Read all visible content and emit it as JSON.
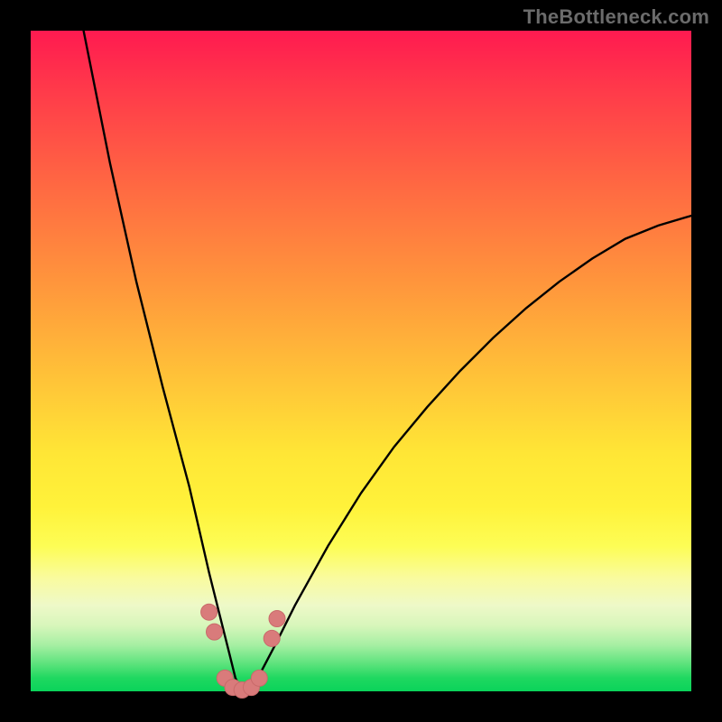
{
  "watermark": "TheBottleneck.com",
  "colors": {
    "frame": "#000000",
    "curve": "#000000",
    "marker_fill": "#d97b7b",
    "marker_stroke": "#c96a6a"
  },
  "chart_data": {
    "type": "line",
    "title": "",
    "xlabel": "",
    "ylabel": "",
    "xlim": [
      0,
      100
    ],
    "ylim": [
      0,
      100
    ],
    "grid": false,
    "series": [
      {
        "name": "bottleneck-curve",
        "description": "V-shaped bottleneck curve. y is the mismatch / bottleneck level; minimum near x≈32 where y≈0 (green band). Left arm rises steeply to ~100 at x≈8; right arm rises more gently to ~72 at x=100.",
        "x": [
          8,
          12,
          16,
          20,
          24,
          27,
          28.5,
          30,
          31,
          32,
          33,
          34,
          35,
          37,
          40,
          45,
          50,
          55,
          60,
          65,
          70,
          75,
          80,
          85,
          90,
          95,
          100
        ],
        "values": [
          100,
          80,
          62,
          46,
          31,
          18,
          12,
          6,
          2,
          0,
          0.5,
          1.6,
          3.2,
          7,
          13,
          22,
          30,
          37,
          43,
          48.5,
          53.5,
          58,
          62,
          65.5,
          68.5,
          70.5,
          72
        ]
      }
    ],
    "markers": {
      "name": "highlight-band",
      "description": "Salmon markers near the valley (inside yellow/green band).",
      "points": [
        {
          "x": 27.0,
          "y": 12.0
        },
        {
          "x": 27.8,
          "y": 9.0
        },
        {
          "x": 29.4,
          "y": 2.0
        },
        {
          "x": 30.6,
          "y": 0.6
        },
        {
          "x": 32.0,
          "y": 0.2
        },
        {
          "x": 33.4,
          "y": 0.6
        },
        {
          "x": 34.6,
          "y": 2.0
        },
        {
          "x": 36.5,
          "y": 8.0
        },
        {
          "x": 37.3,
          "y": 11.0
        }
      ]
    }
  }
}
